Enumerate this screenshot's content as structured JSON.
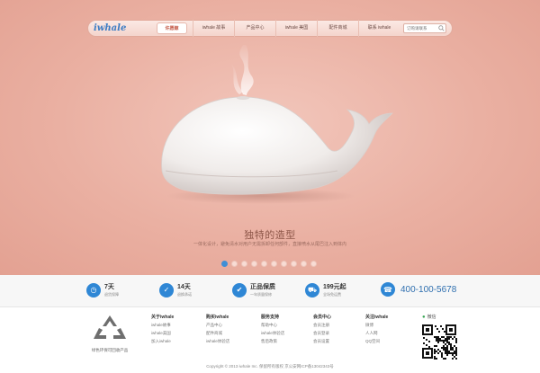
{
  "nav": {
    "logo": "iwhale",
    "items": [
      "许愿鲸",
      "iwhale 故事",
      "产品中心",
      "iwhale 美国",
      "配件商城",
      "联系 iwhale"
    ],
    "search_placeholder": "订购请联系"
  },
  "hero": {
    "slogan": "独特的造型",
    "subline": "一体化设计，避免清水对用户无需拆卸任何部件，直接喷水从尾巴注入到体内",
    "slide_count": 10,
    "active_slide": 0
  },
  "features": [
    {
      "icon": "clock-icon",
      "title": "7天",
      "sub": "退货保障"
    },
    {
      "icon": "tag-icon",
      "title": "14天",
      "sub": "退换承诺"
    },
    {
      "icon": "shield-icon",
      "title": "正品保质",
      "sub": "一年质量保修"
    },
    {
      "icon": "cart-icon",
      "title": "199元起",
      "sub": "全场免运费"
    }
  ],
  "phone": "400-100-5678",
  "eco_label": "绿色环保可回收产品",
  "columns": [
    {
      "head": "关于iwhale",
      "items": [
        "iwhale故事",
        "iwhale美国",
        "加入iwhale"
      ]
    },
    {
      "head": "购买iwhale",
      "items": [
        "产品中心",
        "配件商城",
        "iwhale体验店"
      ]
    },
    {
      "head": "服务支持",
      "items": [
        "帮助中心",
        "iwhale体验店",
        "售后政策"
      ]
    },
    {
      "head": "会员中心",
      "items": [
        "会员注册",
        "会员登录",
        "会员设置"
      ]
    },
    {
      "head": "关注iwhale",
      "items": [
        "微博",
        "人人网",
        "QQ空间"
      ]
    }
  ],
  "wechat": "微信",
  "copyright": "Copyright © 2013 iwhale Inc. 保留所有版权    京公安网ICP备13042343号",
  "colors": {
    "accent": "#2f87d5",
    "hero": "#eab0a2"
  }
}
